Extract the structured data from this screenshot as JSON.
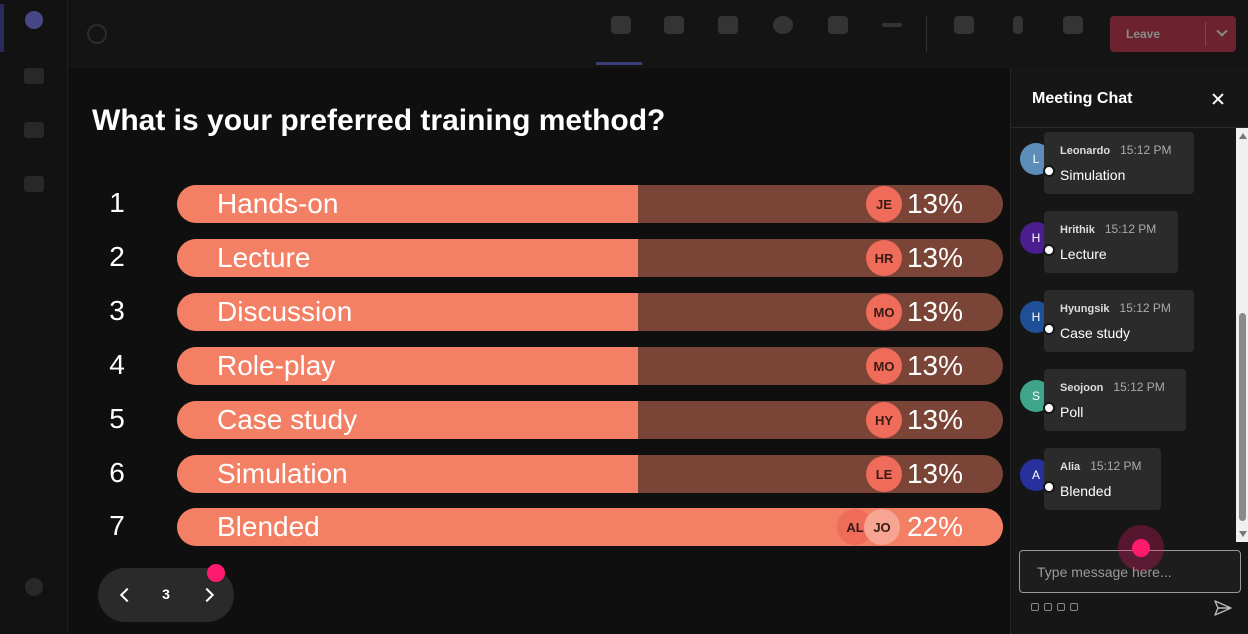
{
  "rail": {
    "items": [
      {
        "name": "activity"
      },
      {
        "name": "communities"
      },
      {
        "name": "chat"
      },
      {
        "name": "calendar"
      },
      {
        "name": "help"
      }
    ]
  },
  "toolbar": {
    "buttons": [
      {
        "name": "chat"
      },
      {
        "name": "people"
      },
      {
        "name": "raise"
      },
      {
        "name": "react"
      },
      {
        "name": "view"
      },
      {
        "name": "more"
      },
      {
        "name": "camera"
      },
      {
        "name": "mic"
      },
      {
        "name": "share"
      }
    ],
    "leave_label": "Leave"
  },
  "poll": {
    "question": "What is your preferred training method?",
    "options": [
      {
        "rank": "1",
        "label": "Hands-on",
        "percent": "13%",
        "fraction": 0.13,
        "voters": [
          "JE"
        ]
      },
      {
        "rank": "2",
        "label": "Lecture",
        "percent": "13%",
        "fraction": 0.13,
        "voters": [
          "HR"
        ]
      },
      {
        "rank": "3",
        "label": "Discussion",
        "percent": "13%",
        "fraction": 0.13,
        "voters": [
          "MO"
        ]
      },
      {
        "rank": "4",
        "label": "Role-play",
        "percent": "13%",
        "fraction": 0.13,
        "voters": [
          "MO"
        ]
      },
      {
        "rank": "5",
        "label": "Case study",
        "percent": "13%",
        "fraction": 0.13,
        "voters": [
          "HY"
        ]
      },
      {
        "rank": "6",
        "label": "Simulation",
        "percent": "13%",
        "fraction": 0.13,
        "voters": [
          "LE"
        ]
      },
      {
        "rank": "7",
        "label": "Blended",
        "percent": "22%",
        "fraction": 0.22,
        "voters": [
          "AL",
          "JO"
        ]
      }
    ]
  },
  "pager": {
    "page": "3"
  },
  "chat": {
    "title": "Meeting Chat",
    "messages": [
      {
        "initial": "L",
        "name": "Leonardo",
        "time": "15:12 PM",
        "text": "Simulation",
        "color": "#5b8db8"
      },
      {
        "initial": "H",
        "name": "Hrithik",
        "time": "15:12 PM",
        "text": "Lecture",
        "color": "#4b1d8f"
      },
      {
        "initial": "H",
        "name": "Hyungsik",
        "time": "15:12 PM",
        "text": "Case study",
        "color": "#1f4f96"
      },
      {
        "initial": "S",
        "name": "Seojoon",
        "time": "15:12 PM",
        "text": "Poll",
        "color": "#3fa58a"
      },
      {
        "initial": "A",
        "name": "Alia",
        "time": "15:12 PM",
        "text": "Blended",
        "color": "#28309e"
      }
    ],
    "input_placeholder": "Type message here..."
  },
  "colors": {
    "bar_fill": "#f38065",
    "bar_track": "#7a4436",
    "accent": "#ff1a6e",
    "leave": "#c4314b"
  }
}
